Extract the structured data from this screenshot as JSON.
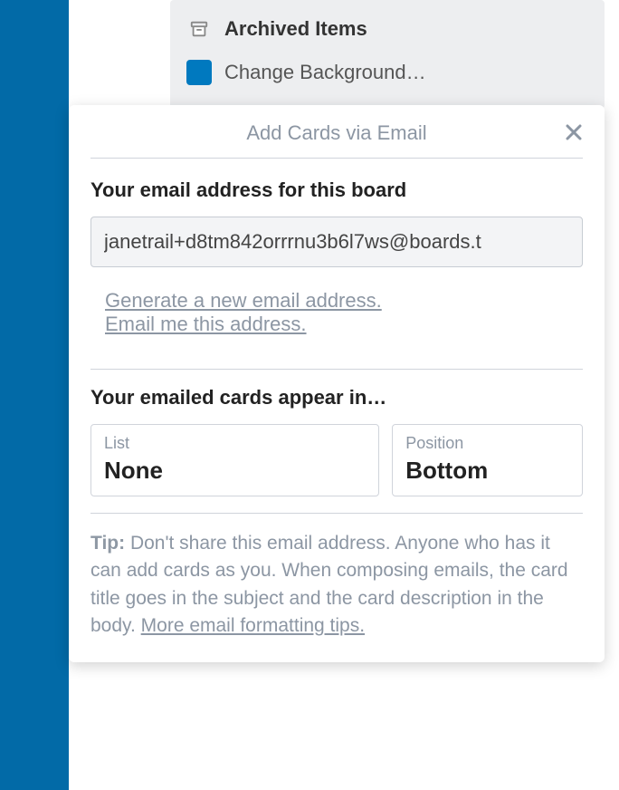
{
  "menu": {
    "archived_label": "Archived Items",
    "change_bg_label": "Change Background…"
  },
  "popover": {
    "title": "Add Cards via Email",
    "email_heading": "Your email address for this board",
    "email_value": "janetrail+d8tm842orrrnu3b6l7ws@boards.t",
    "generate_link": "Generate a new email address.",
    "email_me_link": "Email me this address.",
    "appear_heading": "Your emailed cards appear in…",
    "list_label": "List",
    "list_value": "None",
    "position_label": "Position",
    "position_value": "Bottom",
    "tip_label": "Tip:",
    "tip_text": " Don't share this email address. Anyone who has it can add cards as you. When composing emails, the card title goes in the subject and the card description in the body. ",
    "tip_link": "More email formatting tips."
  }
}
